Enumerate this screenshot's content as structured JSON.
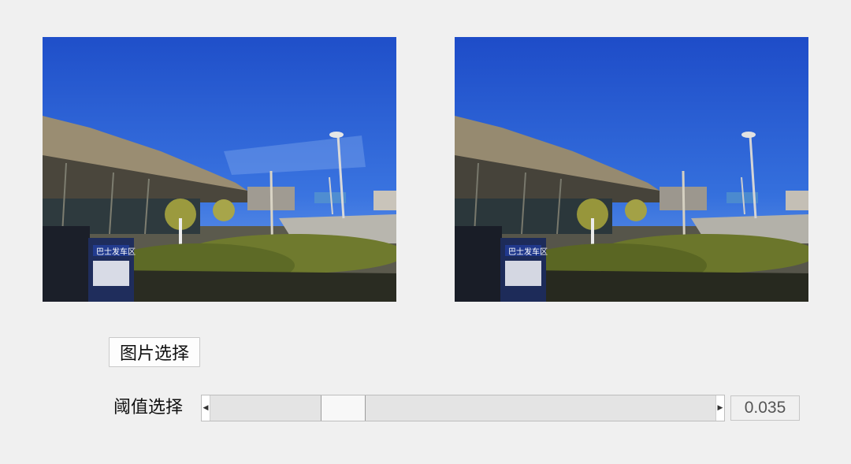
{
  "images": {
    "original_label": "original-photo",
    "processed_label": "processed-photo",
    "sign_text": "巴士发车区"
  },
  "controls": {
    "select_button_label": "图片选择",
    "threshold_label": "阈值选择",
    "threshold_value": "0.035",
    "threshold_level": 0.24
  }
}
